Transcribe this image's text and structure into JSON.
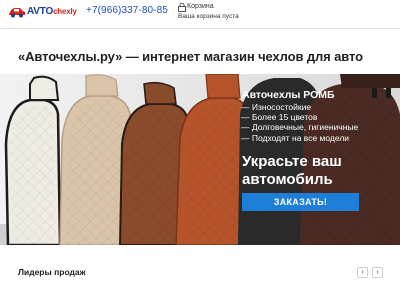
{
  "header": {
    "logo": {
      "main": "AVTO",
      "accent": "chexly"
    },
    "phone": "+7(966)337-80-85",
    "cart": {
      "title": "Корзина",
      "status": "Ваша корзина пуста"
    }
  },
  "headline": "«Авточехлы.ру» — интернет магазин чехлов для авто",
  "banner": {
    "title": "Авточехлы РОМБ",
    "features": [
      "Износостойкие",
      "Более 15 цветов",
      "Долговечные, гигиеничные",
      "Подходят на все модели"
    ],
    "slogan": "Украсьте ваш автомобиль",
    "button": "ЗАКАЗАТЬ!"
  },
  "bestsellers": {
    "title": "Лидеры продаж",
    "prev": "‹",
    "next": "›"
  },
  "colors": {
    "brand_blue": "#1f3f8f",
    "brand_red": "#d6261e",
    "button": "#1e7fd9",
    "phone": "#1f4fbf"
  },
  "icons": [
    "car-logo-icon",
    "lock-cart-icon",
    "chevron-left-icon",
    "chevron-right-icon"
  ]
}
